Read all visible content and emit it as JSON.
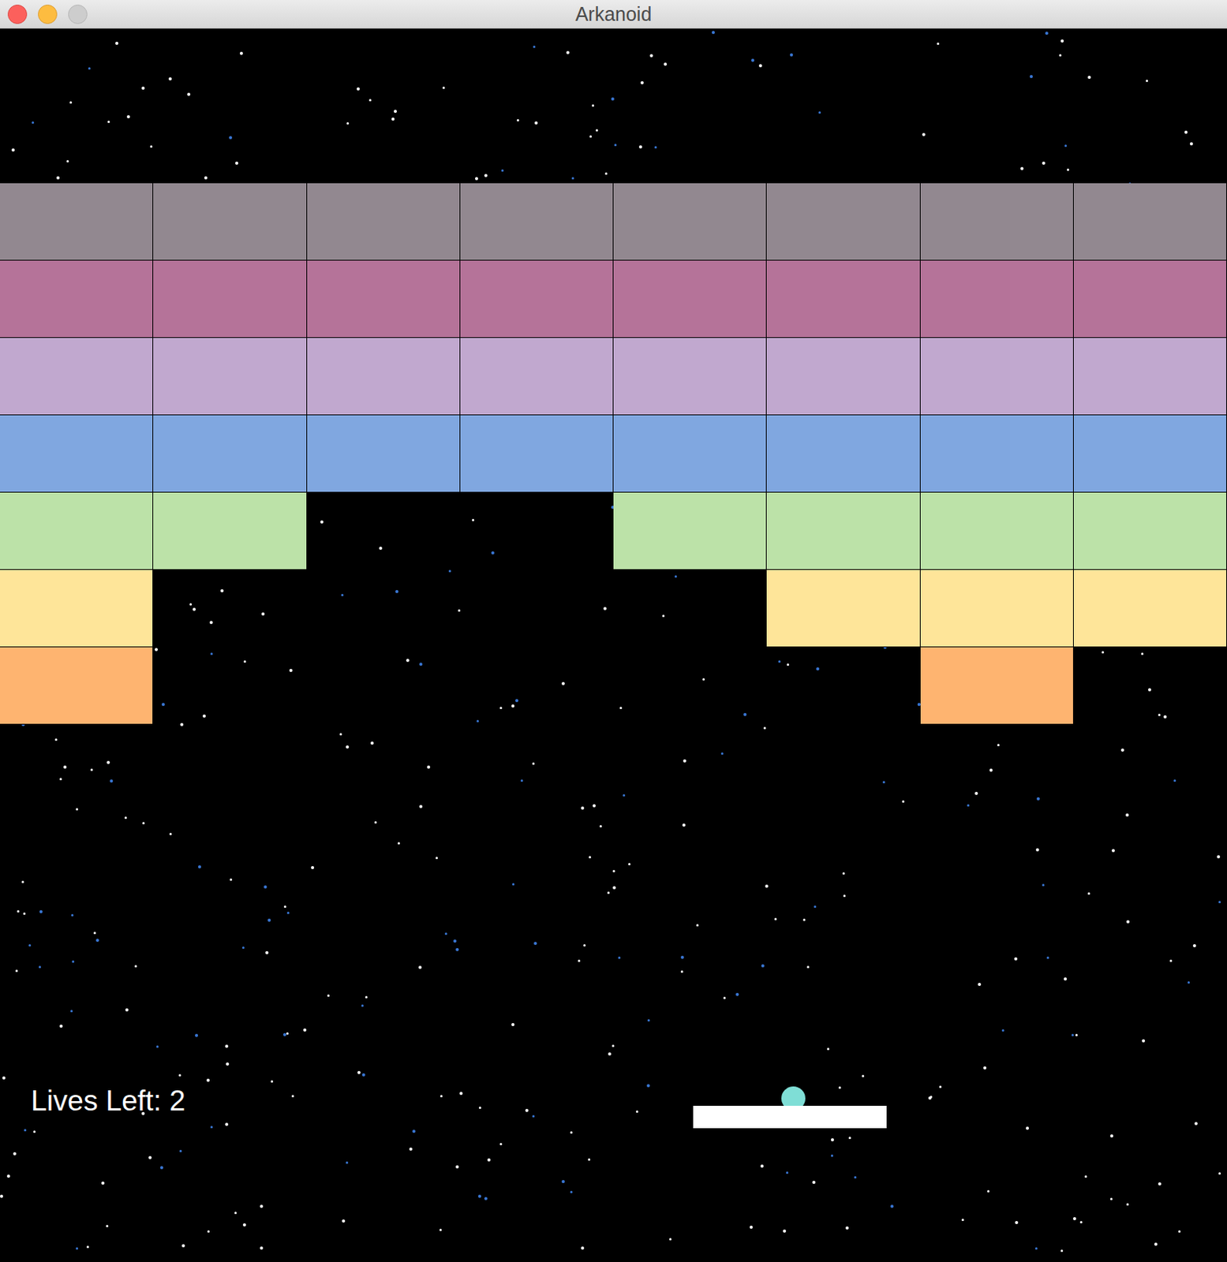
{
  "window": {
    "title": "Arkanoid"
  },
  "bricks": {
    "rows": [
      {
        "color": "#928890",
        "present": [
          true,
          true,
          true,
          true,
          true,
          true,
          true,
          true
        ]
      },
      {
        "color": "#b57399",
        "present": [
          true,
          true,
          true,
          true,
          true,
          true,
          true,
          true
        ]
      },
      {
        "color": "#c1a8cf",
        "present": [
          true,
          true,
          true,
          true,
          true,
          true,
          true,
          true
        ]
      },
      {
        "color": "#80a7e0",
        "present": [
          true,
          true,
          true,
          true,
          true,
          true,
          true,
          true
        ]
      },
      {
        "color": "#bce2a8",
        "present": [
          true,
          true,
          false,
          false,
          true,
          true,
          true,
          true
        ]
      },
      {
        "color": "#fee599",
        "present": [
          true,
          false,
          false,
          false,
          false,
          true,
          true,
          true
        ]
      },
      {
        "color": "#feb470",
        "present": [
          true,
          false,
          false,
          false,
          false,
          false,
          true,
          false
        ]
      }
    ]
  },
  "lives": {
    "text": "Lives Left: 2"
  }
}
